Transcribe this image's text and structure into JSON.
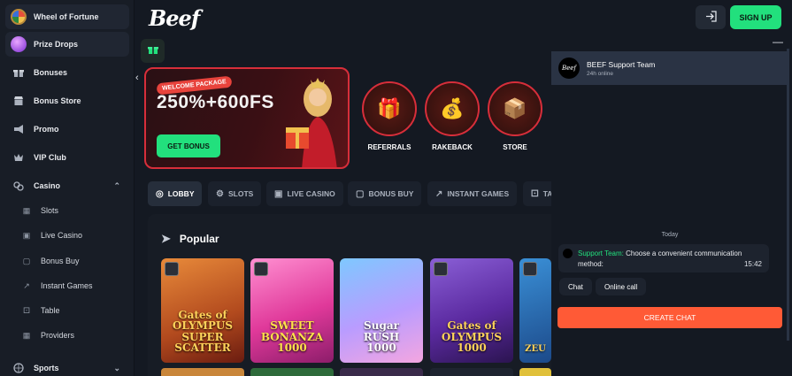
{
  "sidebar": {
    "items": [
      {
        "label": "Wheel of Fortune",
        "icon": "wheel-icon"
      },
      {
        "label": "Prize Drops",
        "icon": "prize-drops-icon"
      },
      {
        "label": "Bonuses",
        "icon": "gift-icon"
      },
      {
        "label": "Bonus Store",
        "icon": "store-icon"
      },
      {
        "label": "Promo",
        "icon": "megaphone-icon"
      },
      {
        "label": "VIP Club",
        "icon": "crown-icon"
      },
      {
        "label": "Casino",
        "icon": "casino-icon"
      },
      {
        "label": "Sports",
        "icon": "sports-icon"
      }
    ],
    "casino_sub": [
      {
        "label": "Slots",
        "icon": "slots-icon"
      },
      {
        "label": "Live Casino",
        "icon": "live-casino-icon"
      },
      {
        "label": "Bonus Buy",
        "icon": "bonus-buy-icon"
      },
      {
        "label": "Instant Games",
        "icon": "instant-games-icon"
      },
      {
        "label": "Table",
        "icon": "table-icon"
      },
      {
        "label": "Providers",
        "icon": "providers-icon"
      }
    ]
  },
  "header": {
    "logo": "Beef",
    "signup_label": "SIGN UP"
  },
  "banner": {
    "tag": "WELCOME PACKAGE",
    "amount": "250%+600FS",
    "button": "GET BONUS"
  },
  "promos": [
    {
      "label": "REFERRALS"
    },
    {
      "label": "RAKEBACK"
    },
    {
      "label": "STORE"
    }
  ],
  "tabs": [
    {
      "label": "LOBBY",
      "active": true
    },
    {
      "label": "SLOTS"
    },
    {
      "label": "LIVE CASINO"
    },
    {
      "label": "BONUS BUY"
    },
    {
      "label": "INSTANT GAMES"
    },
    {
      "label": "TA"
    }
  ],
  "popular": {
    "title": "Popular",
    "games": [
      {
        "title": "GATES OF OLYMPUS SUPER SCATTER",
        "display": "Gates of\nOLYMPUS\nSUPER SCATTER"
      },
      {
        "title": "SWEET BONANZA 1000",
        "display": "SWEET\nBONANZA\n1000"
      },
      {
        "title": "SUGAR RUSH 1000",
        "display": "Sugar\nRUSH\n1000"
      },
      {
        "title": "GATES OF OLYMPUS 1000",
        "display": "Gates of\nOLYMPUS\n1000"
      },
      {
        "title": "ZEUS",
        "display": "ZEU"
      }
    ]
  },
  "chat": {
    "team_name": "BEEF Support Team",
    "status": "24h online",
    "today": "Today",
    "sender": "Support Team:",
    "message": "Choose a convenient communication method:",
    "time": "15:42",
    "options": [
      "Chat",
      "Online call"
    ],
    "create_label": "CREATE CHAT",
    "avatar_text": "Beef"
  },
  "colors": {
    "accent_green": "#22e07d",
    "accent_red": "#d72e3a",
    "chat_orange": "#ff5a36",
    "bg": "#141922"
  }
}
